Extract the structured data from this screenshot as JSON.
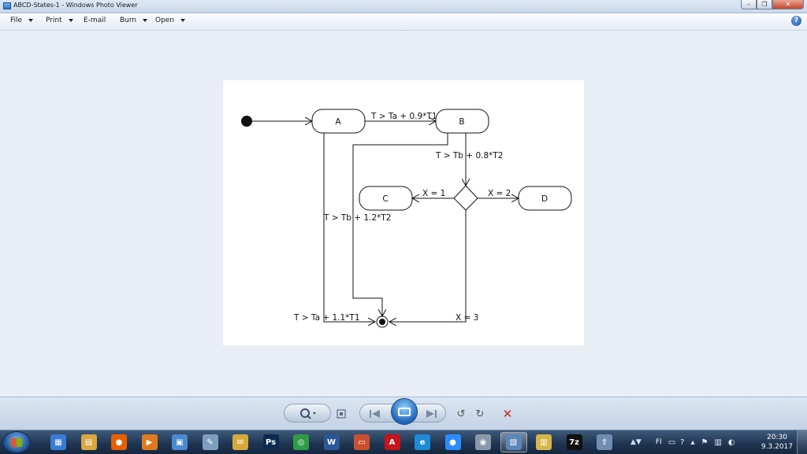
{
  "window": {
    "title": "ABCD-States-1 - Windows Photo Viewer",
    "min_glyph": "–",
    "max_glyph": "❐",
    "close_glyph": "✕"
  },
  "menu": {
    "file": "File",
    "print": "Print",
    "email": "E-mail",
    "burn": "Burn",
    "open": "Open",
    "help_glyph": "?"
  },
  "diagram": {
    "states": [
      "A",
      "B",
      "C",
      "D"
    ],
    "transitions": {
      "a_to_b": "T > Ta + 0.9*T1",
      "b_to_choice": "T > Tb + 0.8*T2",
      "choice_to_c": "X = 1",
      "choice_to_d": "X = 2",
      "b_to_final": "T > Tb + 1.2*T2",
      "a_to_final": "T > Ta + 1.1*T1",
      "choice_to_final": "X = 3"
    }
  },
  "controls": {
    "zoom": "zoom-icon",
    "actual_size": "fit-icon",
    "previous": "previous-icon",
    "slideshow": "slideshow-icon",
    "next": "next-icon",
    "rotate_ccw": "↺",
    "rotate_cw": "↻",
    "delete": "✕"
  },
  "taskbar": {
    "apps": [
      {
        "name": "libraries-icon",
        "glyph": "▦",
        "color": "#3a7bd5"
      },
      {
        "name": "file-explorer-icon",
        "glyph": "▤",
        "color": "#d9a640"
      },
      {
        "name": "firefox-icon",
        "glyph": "●",
        "color": "#e66000"
      },
      {
        "name": "media-player-icon",
        "glyph": "▶",
        "color": "#e07a1f"
      },
      {
        "name": "network-icon",
        "glyph": "▣",
        "color": "#4a8ad1"
      },
      {
        "name": "paint-icon",
        "glyph": "✎",
        "color": "#7f9fbf"
      },
      {
        "name": "outlook-icon",
        "glyph": "✉",
        "color": "#d8a93a"
      },
      {
        "name": "photoshop-icon",
        "glyph": "Ps",
        "color": "#0b2c4e"
      },
      {
        "name": "chrome-icon",
        "glyph": "◎",
        "color": "#2f9b48"
      },
      {
        "name": "word-icon",
        "glyph": "W",
        "color": "#2b5797"
      },
      {
        "name": "slides-icon",
        "glyph": "▭",
        "color": "#c8502f"
      },
      {
        "name": "acrobat-icon",
        "glyph": "A",
        "color": "#c4161c"
      },
      {
        "name": "internet-explorer-icon",
        "glyph": "e",
        "color": "#1e8bd6"
      },
      {
        "name": "zoom-app-icon",
        "glyph": "●",
        "color": "#2d8cff"
      },
      {
        "name": "security-icon",
        "glyph": "◉",
        "color": "#8a99aa"
      },
      {
        "name": "photo-viewer-icon",
        "glyph": "▧",
        "color": "#5b86b8"
      },
      {
        "name": "notes-icon",
        "glyph": "▥",
        "color": "#d8b54a"
      },
      {
        "name": "7zip-icon",
        "glyph": "7z",
        "color": "#111111"
      },
      {
        "name": "upload-icon",
        "glyph": "⇧",
        "color": "#6f8db2"
      }
    ],
    "language": "FI",
    "time": "20:30",
    "date": "9.3.2017"
  }
}
